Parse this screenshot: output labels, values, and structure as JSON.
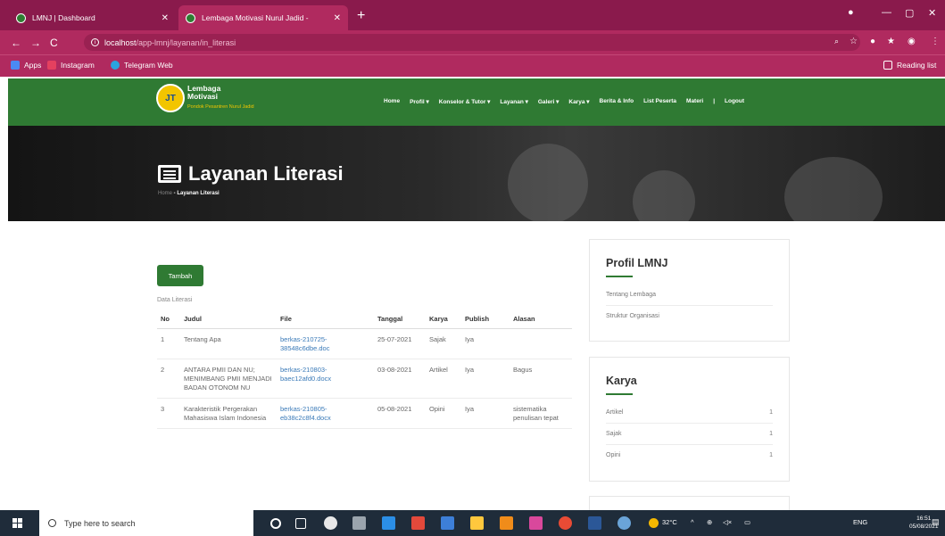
{
  "browser": {
    "tabs": [
      {
        "title": "LMNJ | Dashboard",
        "active": false
      },
      {
        "title": "Lembaga Motivasi Nurul Jadid - ",
        "active": true
      }
    ],
    "url_host": "localhost",
    "url_path": "/app-lmnj/layanan/in_literasi",
    "bookmarks": [
      "Apps",
      "Instagram",
      "Telegram Web"
    ],
    "reading_list": "Reading list"
  },
  "site": {
    "logo_title": "Lembaga\nMotivasi",
    "logo_subtitle": "Pondok Pesantren Nurul Jadid",
    "menu": [
      "Home",
      "Profil ▾",
      "Konselor & Tutor ▾",
      "Layanan ▾",
      "Galeri ▾",
      "Karya ▾",
      "Berita & Info",
      "List Peserta",
      "Materi",
      "|",
      "Logout"
    ]
  },
  "hero": {
    "title": "Layanan Literasi",
    "breadcrumb_home": "Home",
    "breadcrumb_current": " - Layanan Literasi"
  },
  "main": {
    "add_button": "Tambah",
    "caption": "Data Literasi",
    "columns": [
      "No",
      "Judul",
      "File",
      "Tanggal",
      "Karya",
      "Publish",
      "Alasan"
    ],
    "rows": [
      [
        "1",
        "Tentang Apa",
        "berkas-210725-38548c6dbe.doc",
        "25-07-2021",
        "Sajak",
        "Iya",
        ""
      ],
      [
        "2",
        "ANTARA PMII DAN NU; MENIMBANG PMII MENJADI BADAN OTONOM NU",
        "berkas-210803-baec12afd0.docx",
        "03-08-2021",
        "Artikel",
        "Iya",
        "Bagus"
      ],
      [
        "3",
        "Karakteristik Pergerakan Mahasiswa Islam Indonesia",
        "berkas-210805-eb38c2c8f4.docx",
        "05-08-2021",
        "Opini",
        "Iya",
        "sistematika penulisan tepat"
      ]
    ]
  },
  "sidebar": {
    "profil": {
      "title": "Profil LMNJ",
      "items": [
        "Tentang Lembaga",
        "Struktur Organisasi"
      ]
    },
    "karya": {
      "title": "Karya",
      "items": [
        {
          "label": "Artikel",
          "count": "1"
        },
        {
          "label": "Sajak",
          "count": "1"
        },
        {
          "label": "Opini",
          "count": "1"
        }
      ]
    }
  },
  "taskbar": {
    "search_placeholder": "Type here to search",
    "weather": "32°C",
    "language": "ENG",
    "time": "16:51",
    "date": "05/08/2021"
  },
  "colors": {
    "browser_frame": "#8a1a4c",
    "toolbar": "#b02a5f",
    "site_green": "#2f7a33",
    "link_blue": "#3a7ab8"
  }
}
